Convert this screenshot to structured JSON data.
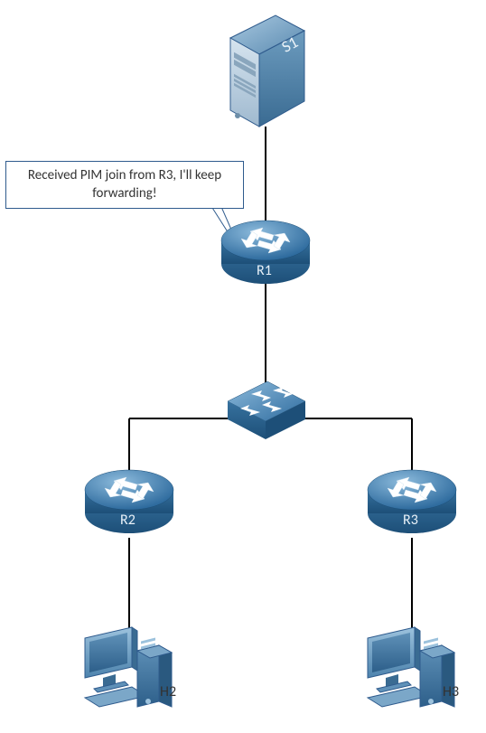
{
  "callout": {
    "line1": "Received PIM join from R3, I'll keep",
    "line2": "forwarding!"
  },
  "nodes": {
    "s1": {
      "label": "S1",
      "type": "server"
    },
    "r1": {
      "label": "R1",
      "type": "router"
    },
    "r2": {
      "label": "R2",
      "type": "router"
    },
    "r3": {
      "label": "R3",
      "type": "router"
    },
    "sw": {
      "label": "",
      "type": "switch"
    },
    "h2": {
      "label": "H2",
      "type": "host"
    },
    "h3": {
      "label": "H3",
      "type": "host"
    }
  },
  "links": [
    [
      "s1",
      "r1"
    ],
    [
      "r1",
      "sw"
    ],
    [
      "sw",
      "r2"
    ],
    [
      "sw",
      "r3"
    ],
    [
      "r2",
      "h2"
    ],
    [
      "r3",
      "h3"
    ]
  ]
}
